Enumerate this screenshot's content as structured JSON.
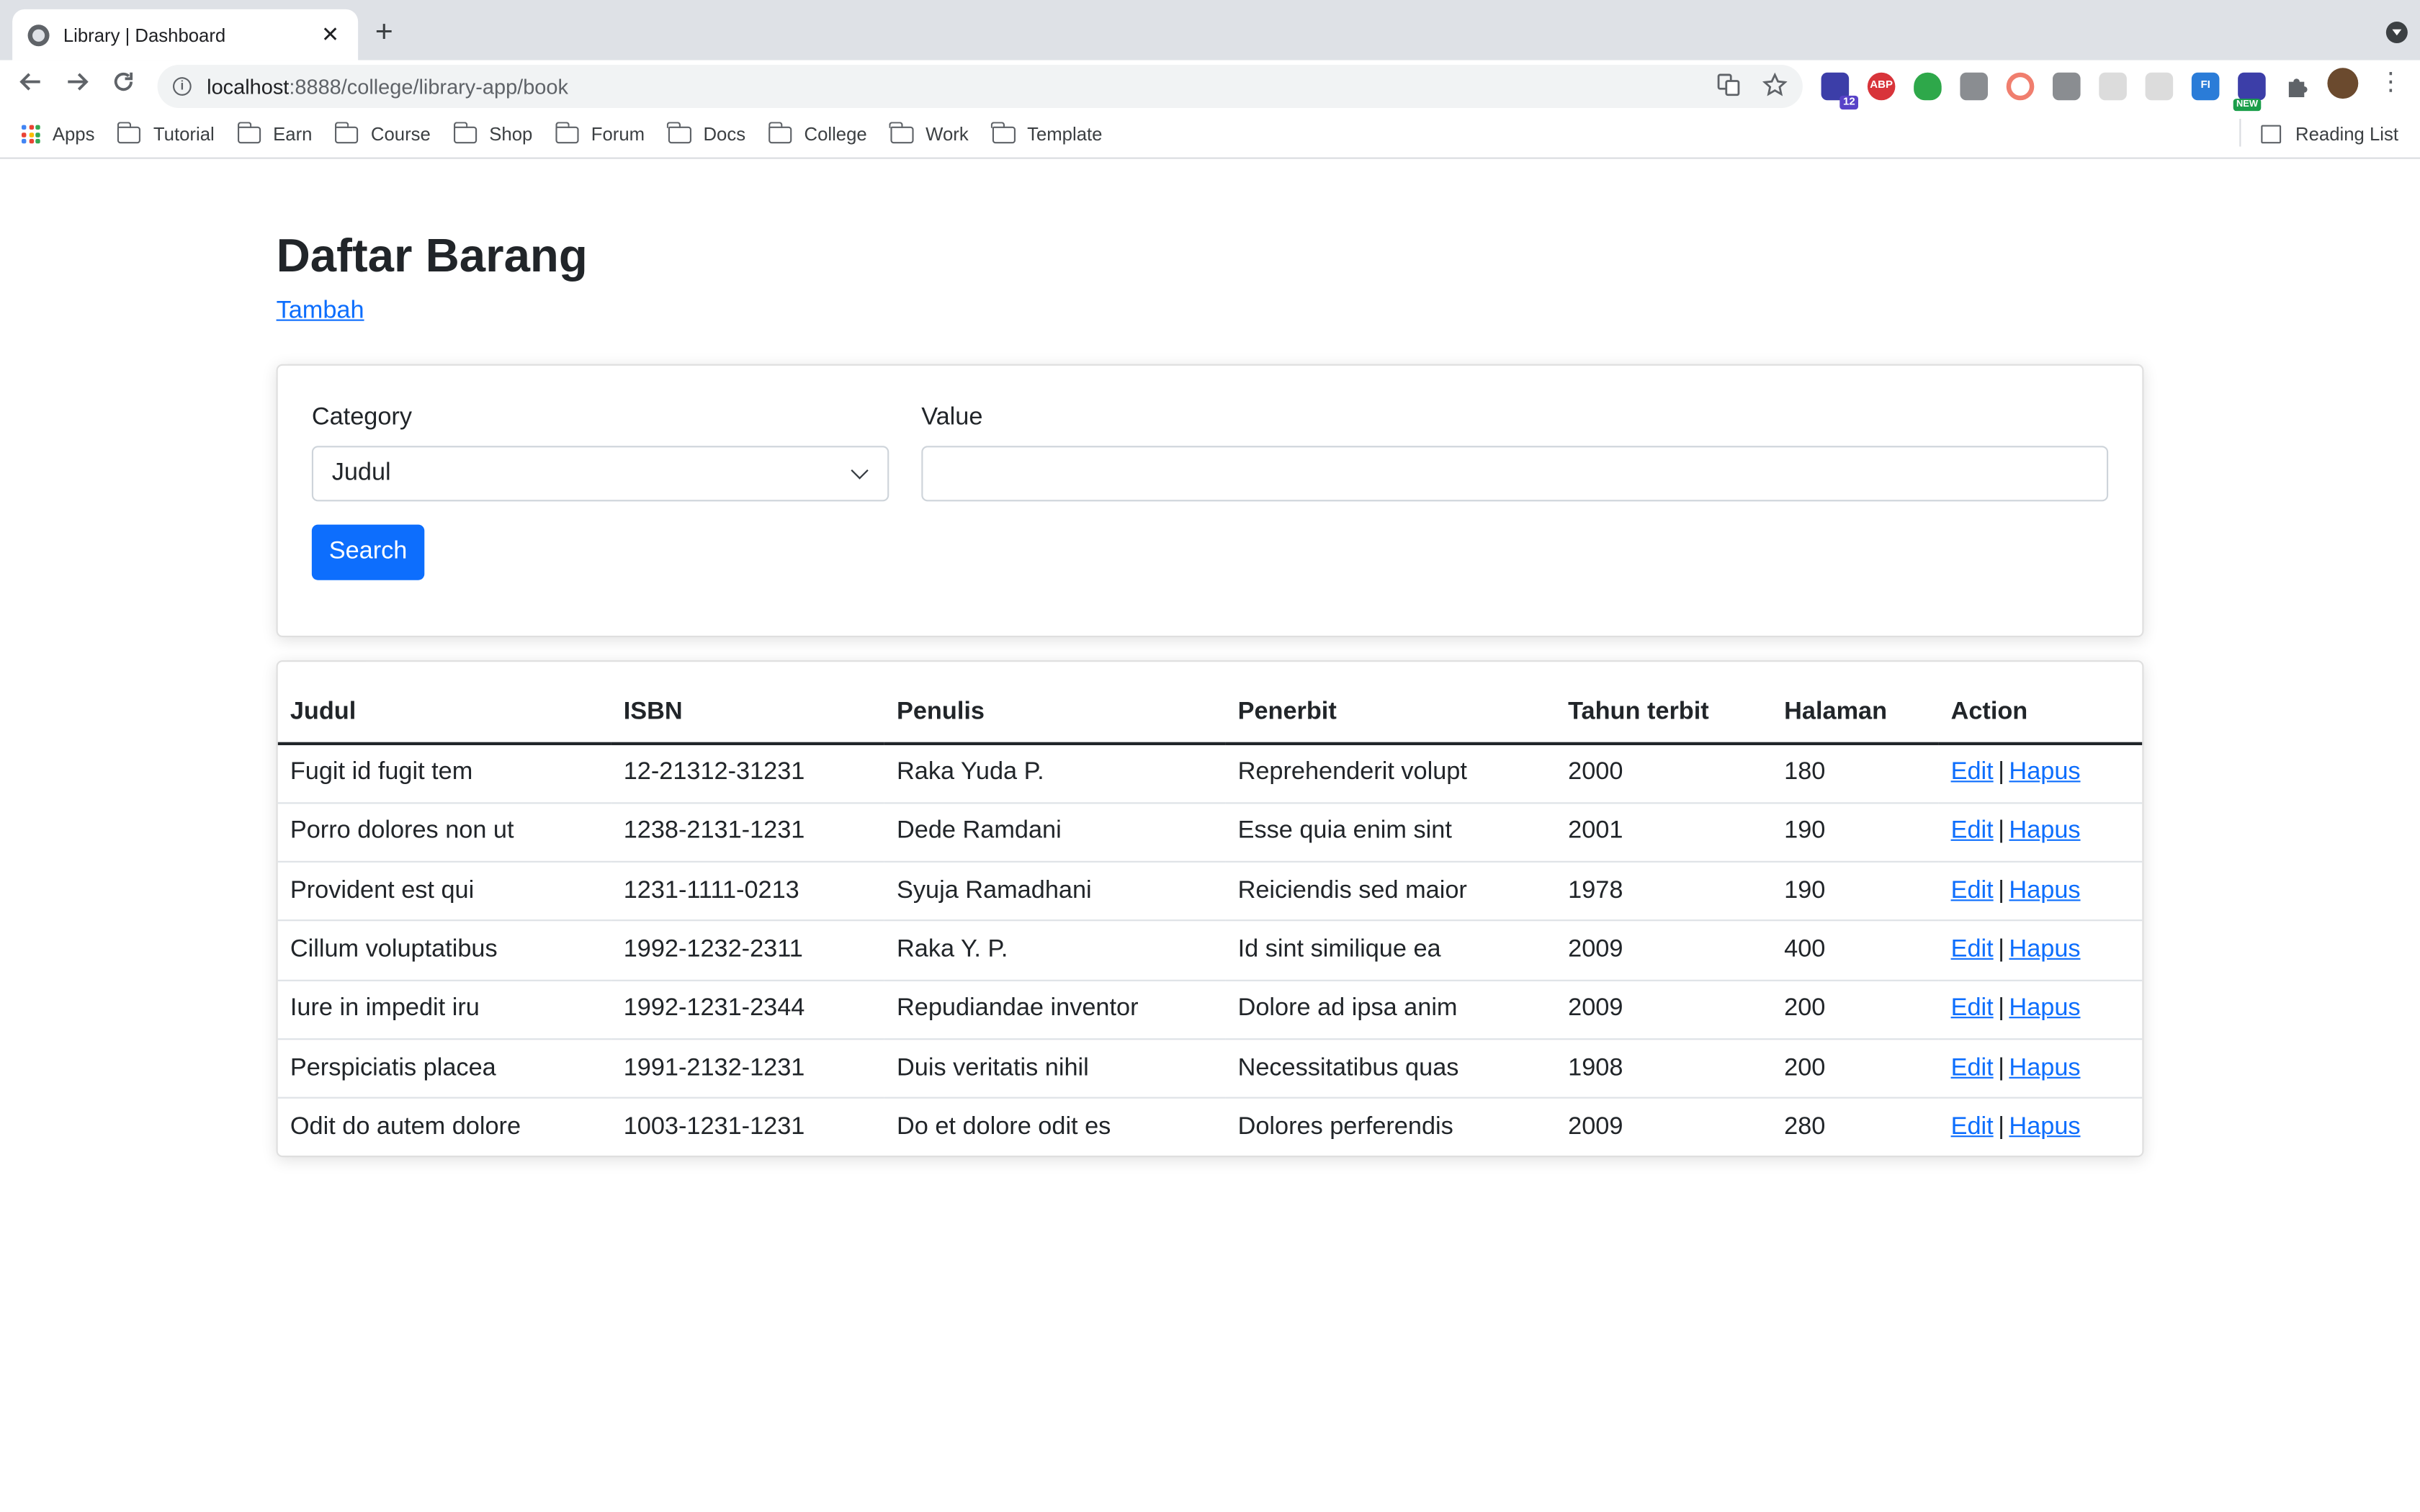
{
  "browser": {
    "tab_title": "Library | Dashboard",
    "tab_close": "✕",
    "new_tab": "+",
    "url_host": "localhost",
    "url_path": ":8888/college/library-app/book",
    "ext_badge_count": "12",
    "ext_abp": "ABP",
    "ext_fi": "FI",
    "ext_new": "NEW",
    "bookmarks": [
      "Apps",
      "Tutorial",
      "Earn",
      "Course",
      "Shop",
      "Forum",
      "Docs",
      "College",
      "Work",
      "Template"
    ],
    "reading_list": "Reading List"
  },
  "page": {
    "title": "Daftar Barang",
    "add_link": "Tambah"
  },
  "search": {
    "category_label": "Category",
    "category_selected": "Judul",
    "value_label": "Value",
    "value_text": "",
    "button": "Search"
  },
  "table": {
    "headers": [
      "Judul",
      "ISBN",
      "Penulis",
      "Penerbit",
      "Tahun terbit",
      "Halaman",
      "Action"
    ],
    "action_edit": "Edit",
    "action_sep": "|",
    "action_delete": "Hapus",
    "rows": [
      {
        "judul": "Fugit id fugit tem",
        "isbn": "12-21312-31231",
        "penulis": "Raka Yuda P.",
        "penerbit": "Reprehenderit volupt",
        "tahun": "2000",
        "halaman": "180"
      },
      {
        "judul": "Porro dolores non ut",
        "isbn": "1238-2131-1231",
        "penulis": "Dede Ramdani",
        "penerbit": "Esse quia enim sint",
        "tahun": "2001",
        "halaman": "190"
      },
      {
        "judul": "Provident est qui",
        "isbn": "1231-1111-0213",
        "penulis": "Syuja Ramadhani",
        "penerbit": "Reiciendis sed maior",
        "tahun": "1978",
        "halaman": "190"
      },
      {
        "judul": "Cillum voluptatibus",
        "isbn": "1992-1232-2311",
        "penulis": "Raka Y. P.",
        "penerbit": "Id sint similique ea",
        "tahun": "2009",
        "halaman": "400"
      },
      {
        "judul": "Iure in impedit iru",
        "isbn": "1992-1231-2344",
        "penulis": "Repudiandae inventor",
        "penerbit": "Dolore ad ipsa anim",
        "tahun": "2009",
        "halaman": "200"
      },
      {
        "judul": "Perspiciatis placea",
        "isbn": "1991-2132-1231",
        "penulis": "Duis veritatis nihil",
        "penerbit": "Necessitatibus quas",
        "tahun": "1908",
        "halaman": "200"
      },
      {
        "judul": "Odit do autem dolore",
        "isbn": "1003-1231-1231",
        "penulis": "Do et dolore odit es",
        "penerbit": "Dolores perferendis",
        "tahun": "2009",
        "halaman": "280"
      }
    ]
  },
  "icons": {
    "back": "arrow-left-icon",
    "forward": "arrow-right-icon",
    "reload": "reload-icon",
    "info": "info-icon",
    "translate": "translate-icon",
    "bookmark_star": "star-icon",
    "extensions": "puzzle-icon",
    "menu": "kebab-menu-icon"
  },
  "colors": {
    "primary": "#0d6efd",
    "tab_strip": "#dee1e6",
    "text": "#212529"
  }
}
